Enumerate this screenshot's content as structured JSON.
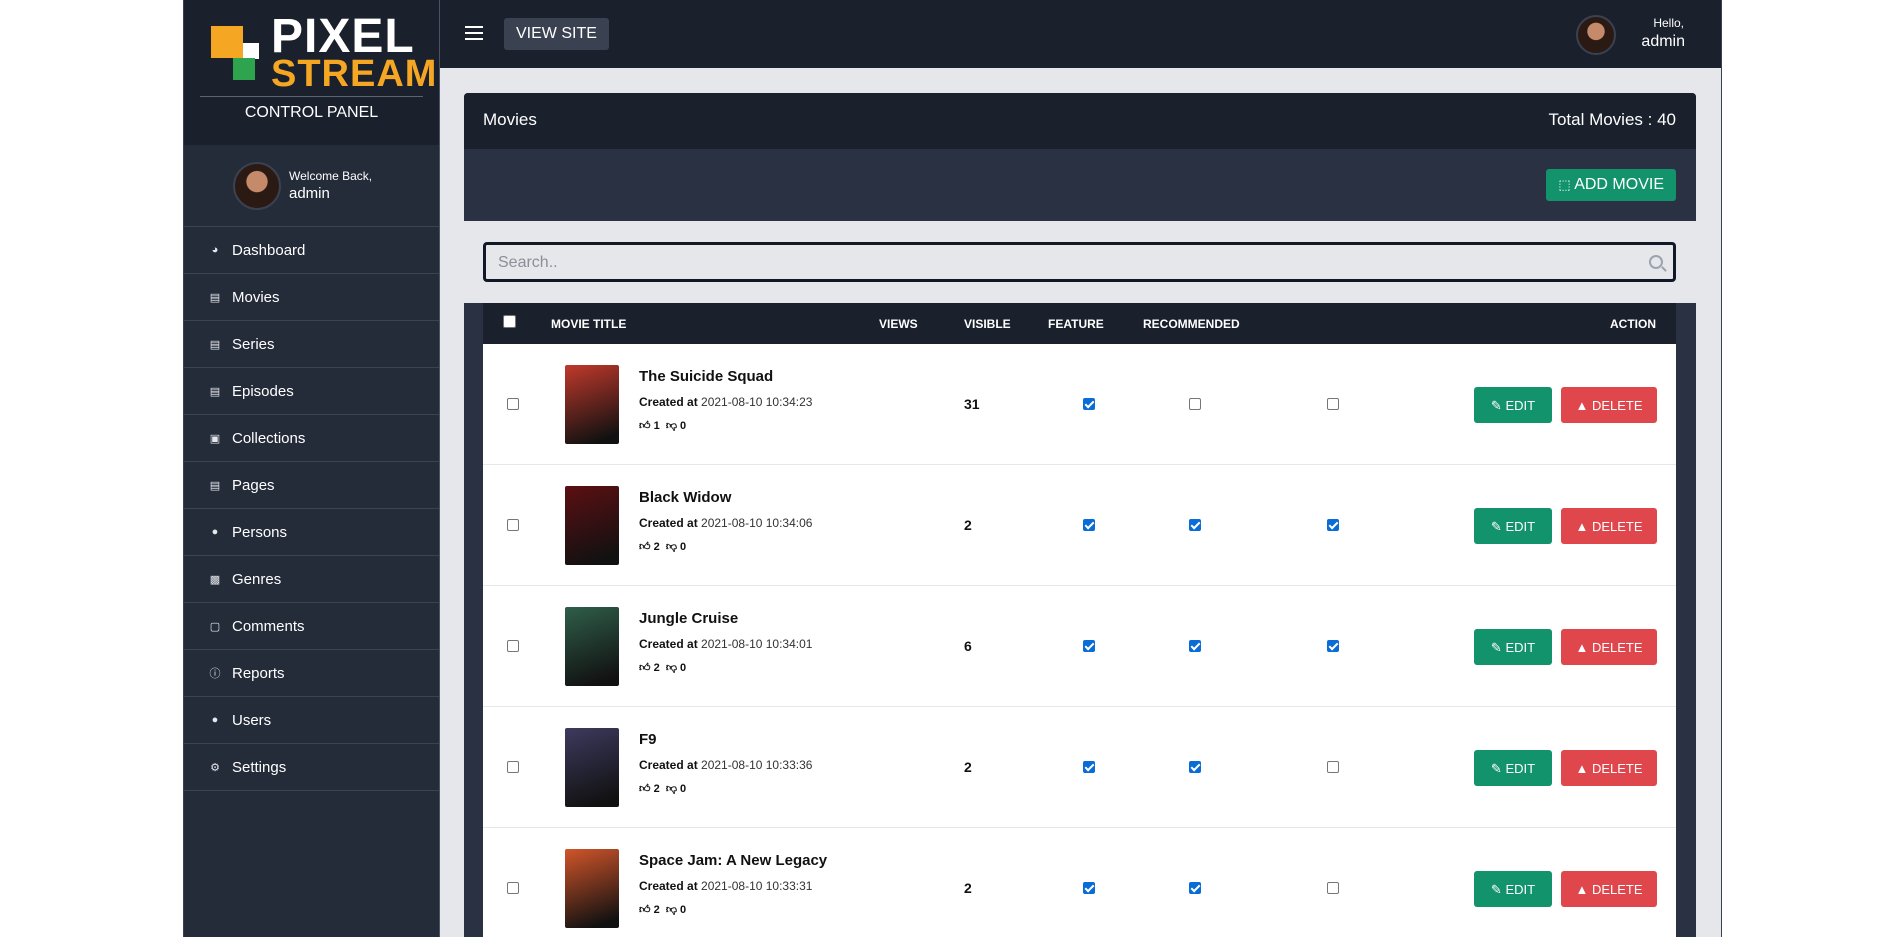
{
  "brand": {
    "logo_top": "PIXEL",
    "logo_bottom": "STREAM",
    "subtitle": "CONTROL PANEL"
  },
  "welcome": {
    "greeting": "Welcome Back,",
    "name": "admin"
  },
  "nav": [
    {
      "label": "Dashboard",
      "icon": "dashboard-icon"
    },
    {
      "label": "Movies",
      "icon": "film-icon"
    },
    {
      "label": "Series",
      "icon": "film-icon"
    },
    {
      "label": "Episodes",
      "icon": "film-icon"
    },
    {
      "label": "Collections",
      "icon": "folder-icon"
    },
    {
      "label": "Pages",
      "icon": "pages-icon"
    },
    {
      "label": "Persons",
      "icon": "people-icon"
    },
    {
      "label": "Genres",
      "icon": "clapper-icon"
    },
    {
      "label": "Comments",
      "icon": "comment-icon"
    },
    {
      "label": "Reports",
      "icon": "alert-icon"
    },
    {
      "label": "Users",
      "icon": "users-icon"
    },
    {
      "label": "Settings",
      "icon": "gear-icon"
    }
  ],
  "topbar": {
    "view_site": "VIEW SITE",
    "hello": "Hello,",
    "user": "admin"
  },
  "card": {
    "title": "Movies",
    "total": "Total Movies : 40",
    "add_button": "ADD MOVIE"
  },
  "search": {
    "placeholder": "Search.."
  },
  "table": {
    "headers": {
      "title": "MOVIE TITLE",
      "views": "VIEWS",
      "visible": "VISIBLE",
      "feature": "FEATURE",
      "recommended": "RECOMMENDED",
      "action": "ACTION"
    },
    "edit_label": "EDIT",
    "delete_label": "DELETE",
    "created_label": "Created at",
    "rows": [
      {
        "title": "The Suicide Squad",
        "created": "2021-08-10 10:34:23",
        "likes": "1",
        "dislikes": "0",
        "views": "31",
        "visible": true,
        "feature": false,
        "recommended": false,
        "poster_color": "#c0392b"
      },
      {
        "title": "Black Widow",
        "created": "2021-08-10 10:34:06",
        "likes": "2",
        "dislikes": "0",
        "views": "2",
        "visible": true,
        "feature": true,
        "recommended": true,
        "poster_color": "#5b0f12"
      },
      {
        "title": "Jungle Cruise",
        "created": "2021-08-10 10:34:01",
        "likes": "2",
        "dislikes": "0",
        "views": "6",
        "visible": true,
        "feature": true,
        "recommended": true,
        "poster_color": "#2f5e4a"
      },
      {
        "title": "F9",
        "created": "2021-08-10 10:33:36",
        "likes": "2",
        "dislikes": "0",
        "views": "2",
        "visible": true,
        "feature": true,
        "recommended": false,
        "poster_color": "#3d3a5e"
      },
      {
        "title": "Space Jam: A New Legacy",
        "created": "2021-08-10 10:33:31",
        "likes": "2",
        "dislikes": "0",
        "views": "2",
        "visible": true,
        "feature": true,
        "recommended": false,
        "poster_color": "#d1552a"
      }
    ]
  },
  "colors": {
    "sidebar": "#242b39",
    "header": "#1a202c",
    "edit": "#12936b",
    "delete": "#e0474c",
    "accent": "#f5a623"
  }
}
